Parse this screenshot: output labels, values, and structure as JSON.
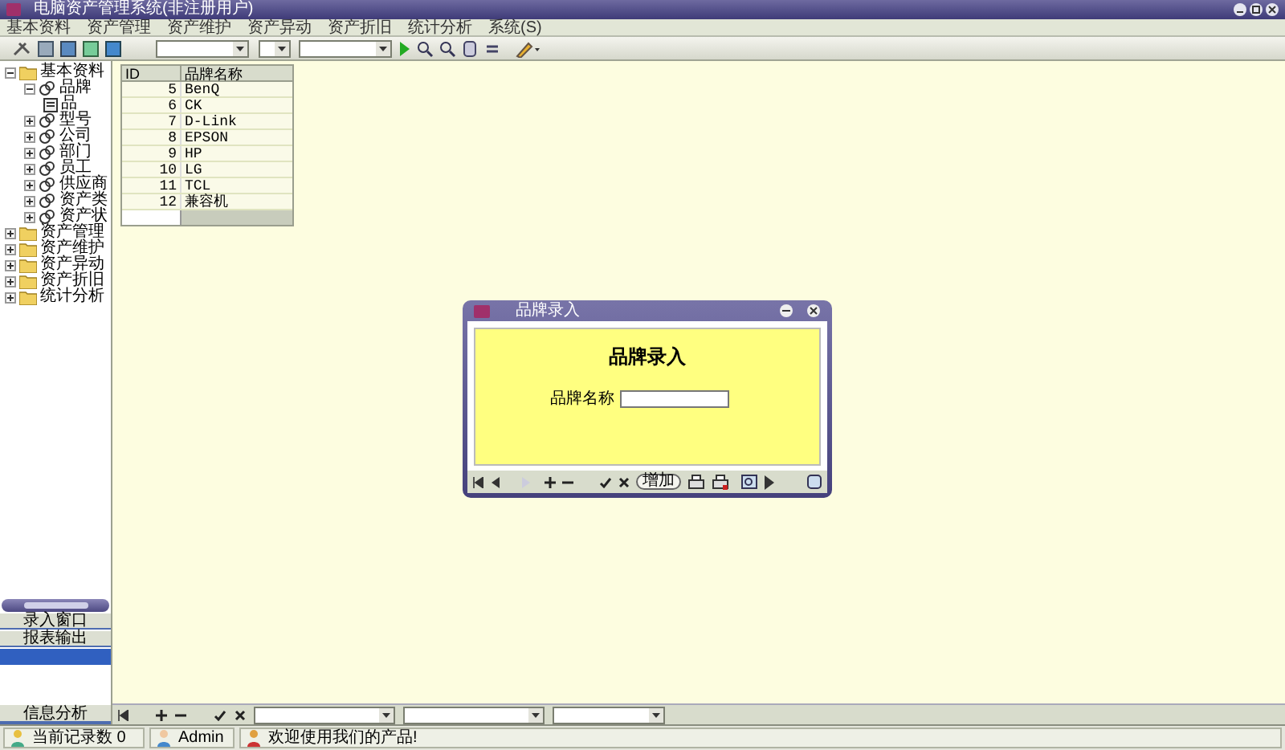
{
  "window": {
    "title": "电脑资产管理系统(非注册用户)"
  },
  "menu": [
    "基本资料",
    "资产管理",
    "资产维护",
    "资产异动",
    "资产折旧",
    "统计分析",
    "系统(S)"
  ],
  "tree": [
    {
      "label": "基本资料",
      "kind": "folder",
      "expanded": true,
      "children": [
        {
          "label": "品牌",
          "kind": "item",
          "expanded": true,
          "children": [
            {
              "label": "品",
              "kind": "form"
            }
          ]
        },
        {
          "label": "型号",
          "kind": "item",
          "expanded": false
        },
        {
          "label": "公司",
          "kind": "item",
          "expanded": false
        },
        {
          "label": "部门",
          "kind": "item",
          "expanded": false
        },
        {
          "label": "员工",
          "kind": "item",
          "expanded": false
        },
        {
          "label": "供应商",
          "kind": "item",
          "expanded": false
        },
        {
          "label": "资产类",
          "kind": "item",
          "expanded": false
        },
        {
          "label": "资产状",
          "kind": "item",
          "expanded": false
        }
      ]
    },
    {
      "label": "资产管理",
      "kind": "folder",
      "expanded": false
    },
    {
      "label": "资产维护",
      "kind": "folder",
      "expanded": false
    },
    {
      "label": "资产异动",
      "kind": "folder",
      "expanded": false
    },
    {
      "label": "资产折旧",
      "kind": "folder",
      "expanded": false
    },
    {
      "label": "统计分析",
      "kind": "folder",
      "expanded": false
    }
  ],
  "side_list": [
    {
      "label": "录入窗口",
      "selected": false
    },
    {
      "label": "报表输出",
      "selected": false
    },
    {
      "selected": true
    }
  ],
  "side_footer": "信息分析",
  "table": {
    "columns": [
      "ID",
      "品牌名称"
    ],
    "rows": [
      [
        "5",
        "BenQ"
      ],
      [
        "6",
        "CK"
      ],
      [
        "7",
        "D-Link"
      ],
      [
        "8",
        "EPSON"
      ],
      [
        "9",
        "HP"
      ],
      [
        "10",
        "LG"
      ],
      [
        "11",
        "TCL"
      ],
      [
        "12",
        "兼容机"
      ]
    ]
  },
  "dialog": {
    "title": "品牌录入",
    "heading": "品牌录入",
    "field_label": "品牌名称",
    "add_button": "增加"
  },
  "status_bar": [
    "当前记录数 0",
    "Admin",
    "欢迎使用我们的产品!"
  ]
}
